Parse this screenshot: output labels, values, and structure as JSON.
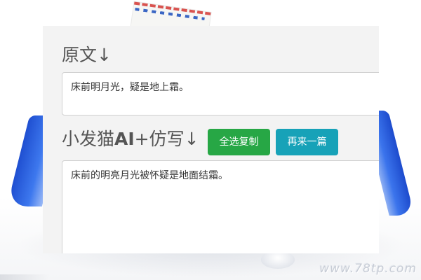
{
  "original": {
    "heading": "原文↓",
    "text": "床前明月光，疑是地上霜。"
  },
  "rewrite": {
    "heading_prefix": "小发猫",
    "heading_ai": "AI",
    "heading_suffix": "+仿写↓",
    "result_text": "床前的明亮月光被怀疑是地面结霜。"
  },
  "buttons": {
    "copy_label": "全选复制",
    "again_label": "再来一篇"
  },
  "watermark": "www.78tp.com",
  "colors": {
    "copy_button": "#27a745",
    "again_button": "#17a2b8",
    "panel_bg": "#f3f3f3",
    "heading_text": "#555555"
  }
}
